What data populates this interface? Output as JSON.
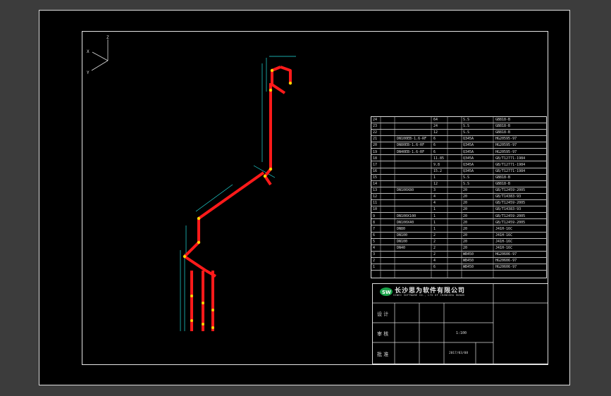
{
  "drawing": {
    "axes": {
      "z": "Z",
      "x": "X",
      "y": "Y"
    },
    "colors": {
      "background": "#000000",
      "pipe": "#ff1a1a",
      "dimension": "#22e0e0",
      "frame": "#e6e6e6"
    }
  },
  "bom": {
    "rows": [
      [
        "24",
        "",
        "",
        "64",
        "",
        "S.S",
        "GB818-B"
      ],
      [
        "23",
        "",
        "",
        "24",
        "",
        "S.S",
        "GB818-B"
      ],
      [
        "22",
        "",
        "",
        "12",
        "",
        "S.S",
        "GB818-B"
      ],
      [
        "21",
        "",
        "DN100EB-1.6-RF",
        "6",
        "",
        "Q345A",
        "HG20595-97"
      ],
      [
        "20",
        "",
        "DN80EB-1.6-RF",
        "6",
        "",
        "Q345A",
        "HG20595-97"
      ],
      [
        "19",
        "",
        "DN40EB-1.6-RF",
        "6",
        "",
        "Q345A",
        "HG20595-97"
      ],
      [
        "18",
        "",
        "",
        "11.85",
        "",
        "Q345A",
        "GB/T12771-1984"
      ],
      [
        "17",
        "",
        "",
        "9.8",
        "",
        "Q345A",
        "GB/T12771-1984"
      ],
      [
        "16",
        "",
        "",
        "15.2",
        "",
        "Q345A",
        "GB/T12771-1984"
      ],
      [
        "15",
        "",
        "",
        "1",
        "",
        "S.S",
        "GB818-B"
      ],
      [
        "14",
        "",
        "",
        "12",
        "",
        "S.S",
        "GB818-B"
      ],
      [
        "13",
        "",
        "DN100X80",
        "3",
        "",
        "20",
        "GB/T12459-2005"
      ],
      [
        "12",
        "",
        "",
        "4",
        "",
        "20",
        "GB/T14383-93"
      ],
      [
        "11",
        "",
        "",
        "4",
        "",
        "20",
        "GB/T12459-2005"
      ],
      [
        "10",
        "",
        "",
        "1",
        "",
        "20",
        "GB/T14383-93"
      ],
      [
        "9",
        "",
        "DN100X100",
        "1",
        "",
        "20",
        "GB/T12459-2005"
      ],
      [
        "8",
        "",
        "DN100X40",
        "1",
        "",
        "20",
        "GB/T12459-2005"
      ],
      [
        "7",
        "",
        "DN80",
        "1",
        "",
        "20",
        "J41H-16C"
      ],
      [
        "6",
        "",
        "DN100",
        "2",
        "",
        "20",
        "J41H-16C"
      ],
      [
        "5",
        "",
        "DN100",
        "2",
        "",
        "20",
        "J41H-16C"
      ],
      [
        "4",
        "",
        "DN40",
        "2",
        "",
        "20",
        "J41H-16C"
      ],
      [
        "3",
        "",
        "",
        "2",
        "",
        "WB450",
        "HG20606-97"
      ],
      [
        "2",
        "",
        "",
        "4",
        "",
        "WB450",
        "HG20606-97"
      ],
      [
        "1",
        "",
        "",
        "6",
        "",
        "WB450",
        "HG20606-97"
      ]
    ]
  },
  "title_block": {
    "company": "长沙思为软件有限公司",
    "company_en": "SIWEI SOFTWARE CO., LTD OF CHANGSHA HUNAN",
    "design_label": "设  计",
    "check_label": "审  核",
    "approve_label": "批  准",
    "scale": "1:100",
    "date": "2017/03/08"
  }
}
